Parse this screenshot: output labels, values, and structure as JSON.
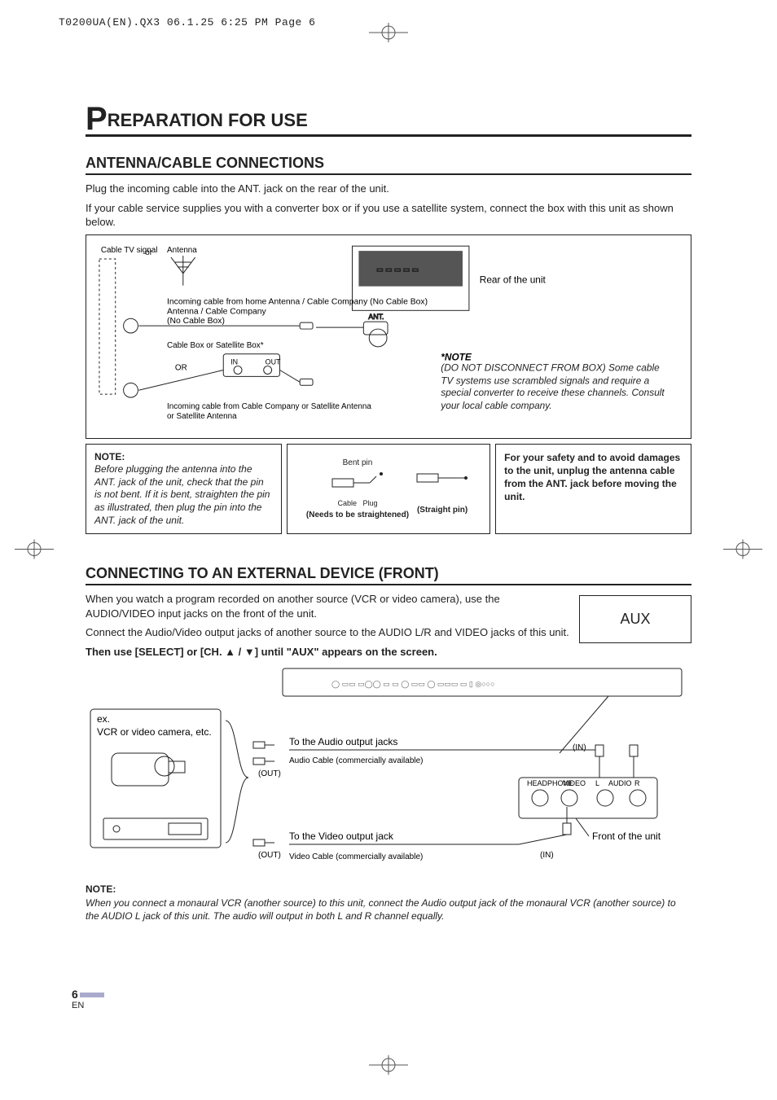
{
  "slug": "T0200UA(EN).QX3  06.1.25  6:25 PM  Page 6",
  "title_cap": "P",
  "title_rest": "REPARATION FOR USE",
  "sect1_title": "ANTENNA/CABLE CONNECTIONS",
  "sect1_p1": "Plug the incoming cable into the ANT. jack on the rear of the unit.",
  "sect1_p2": "If your cable service supplies you with a converter box or if you use a satellite system, connect the box with this unit as shown below.",
  "diagram": {
    "cable_tv_signal": "Cable TV signal",
    "or_small": "or",
    "antenna": "Antenna",
    "incoming_home": "Incoming cable from home Antenna / Cable Company (No Cable Box)",
    "cable_box": "Cable Box or Satellite Box*",
    "or_big": "OR",
    "in_lbl": "IN",
    "out_lbl": "OUT",
    "incoming_company": "Incoming cable from Cable Company or Satellite Antenna",
    "rear": "Rear of the unit",
    "ant_lbl": "ANT.",
    "note_title": "*NOTE",
    "note_body": "(DO NOT DISCONNECT FROM BOX) Some cable TV systems use scrambled signals and require a special converter to receive these channels. Consult your local cable company."
  },
  "noterow": {
    "left_title": "NOTE:",
    "left_body": "Before plugging the antenna into the ANT. jack of the unit, check that the pin is not bent. If it is bent, straighten the pin as illustrated, then plug the pin into the ANT. jack of the unit.",
    "bent_pin": "Bent pin",
    "cable": "Cable",
    "plug": "Plug",
    "needs": "(Needs to be straightened)",
    "straight_pin": "(Straight pin)",
    "right": "For your safety and to avoid damages to the unit, unplug the antenna cable from the ANT. jack before moving the unit."
  },
  "sect2_title": "CONNECTING TO AN EXTERNAL DEVICE (FRONT)",
  "sect2_p1": "When you watch a program recorded on another source (VCR or video camera), use the AUDIO/VIDEO input jacks on the front of the unit.",
  "sect2_p2": "Connect the Audio/Video output jacks of another source to the AUDIO L/R and VIDEO jacks of this unit.",
  "sect2_bold": "Then use [SELECT] or [CH. ▲ / ▼] until \"AUX\" appears on the screen.",
  "aux_label": "AUX",
  "diagram2": {
    "ex": "ex.",
    "src": "VCR or video camera, etc.",
    "to_audio": "To the Audio output jacks",
    "audio_cable": "Audio Cable (commercially available)",
    "to_video": "To the Video output jack",
    "video_cable": "Video Cable (commercially available)",
    "out": "(OUT)",
    "in": "(IN)",
    "headphone": "HEADPHONE",
    "video": "VIDEO",
    "audio": "AUDIO",
    "l": "L",
    "r": "R",
    "front": "Front of the unit"
  },
  "footnote_title": "NOTE:",
  "footnote_body": "When you connect a monaural VCR (another source) to this unit, connect the Audio output jack of the monaural VCR (another source) to the AUDIO L jack of this unit. The audio will output in both L and R channel equally.",
  "page_number": "6",
  "page_lang": "EN"
}
